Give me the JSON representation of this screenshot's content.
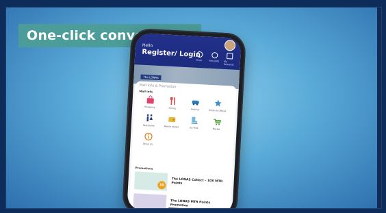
{
  "caption": "One-click convenience",
  "header": {
    "hello": "Hello",
    "register": "Register/ Login",
    "icons": [
      {
        "icon": "scan-icon",
        "label": "Scan"
      },
      {
        "icon": "chat-icon",
        "label": "Receipts"
      },
      {
        "icon": "gift-icon",
        "label": "My Rewards"
      }
    ]
  },
  "banner": {
    "tag": "The LONAS"
  },
  "mall_info": {
    "section_title": "Mall Info & Promotion",
    "subtitle": "Mall Info",
    "tiles": [
      {
        "icon": "shopping-bag-icon",
        "label": "Shopping"
      },
      {
        "icon": "dining-icon",
        "label": "Dining"
      },
      {
        "icon": "car-icon",
        "label": "Parking"
      },
      {
        "icon": "star-icon",
        "label": "Hotels & Offices"
      },
      {
        "icon": "restroom-icon",
        "label": "Restrooms"
      },
      {
        "icon": "wallet-icon",
        "label": "Mobile Wallet"
      },
      {
        "icon": "ice-rink-icon",
        "label": "Ice Rink"
      },
      {
        "icon": "shopping-cart-icon",
        "label": "Market"
      },
      {
        "icon": "info-icon",
        "label": "About Us"
      }
    ]
  },
  "promotions": {
    "subtitle": "Promotions",
    "items": [
      {
        "title": "The LONAS Collect – 10X MTR Points",
        "badge": "10"
      },
      {
        "title": "The LONAS MTR Points Promotion"
      }
    ]
  }
}
